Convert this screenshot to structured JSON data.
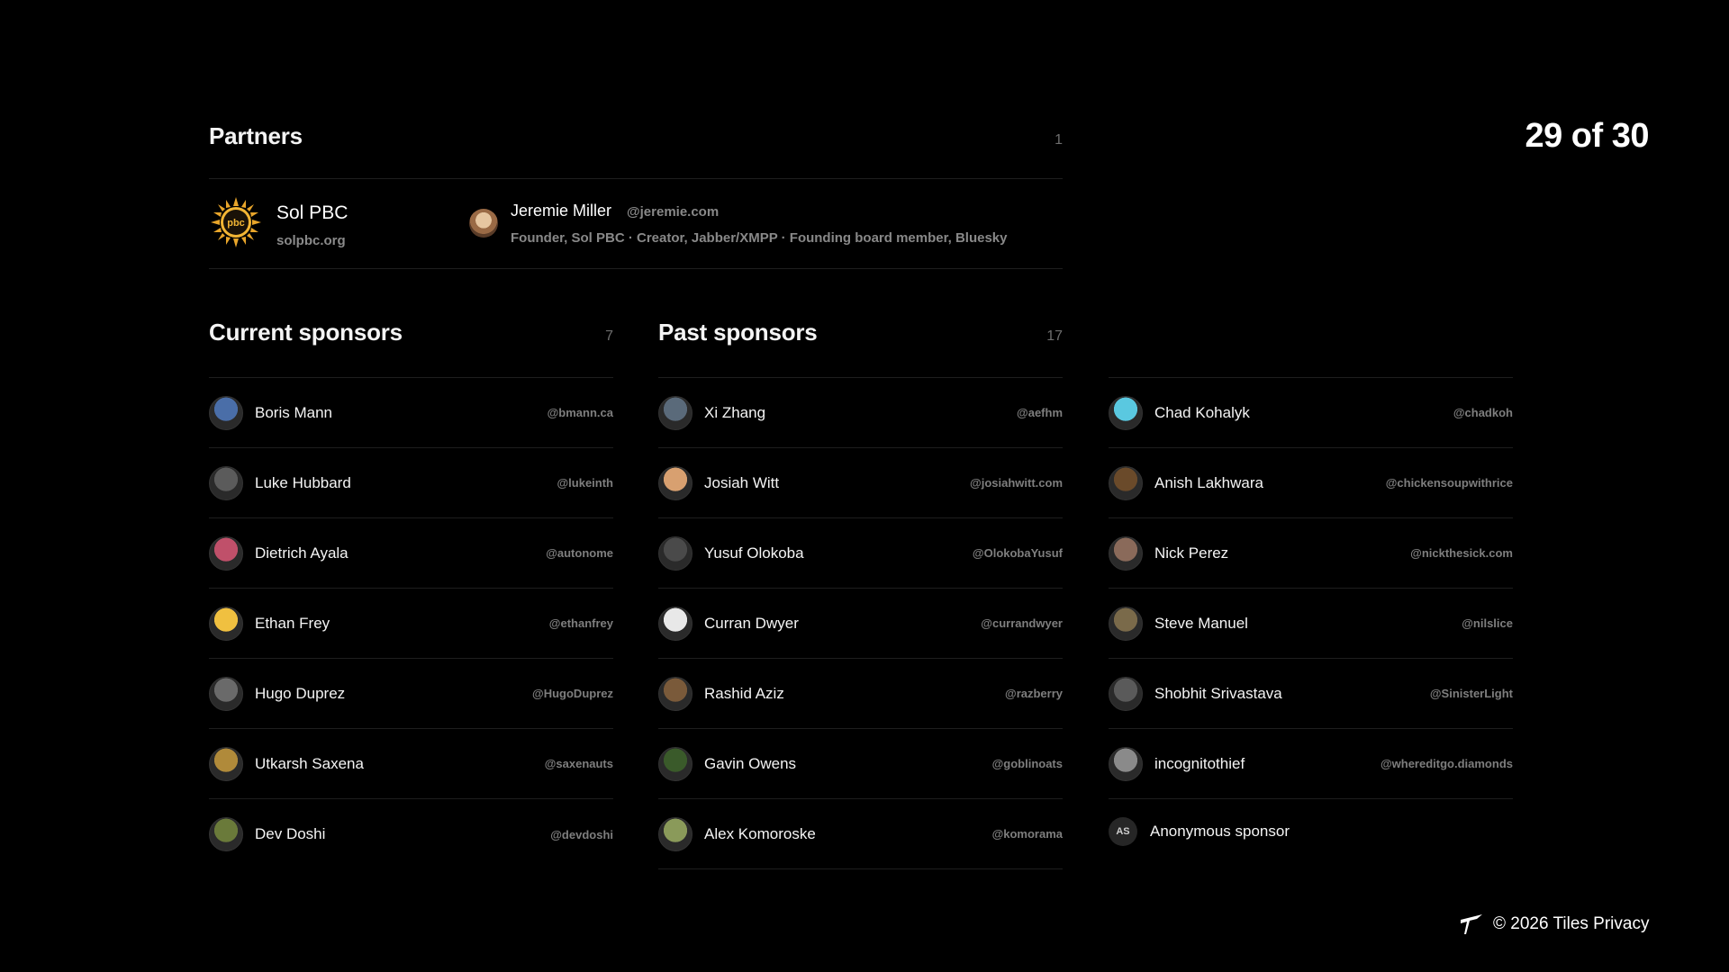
{
  "page_counter": "29 of 30",
  "partners": {
    "title": "Partners",
    "count": "1",
    "org_name": "Sol PBC",
    "org_site": "solpbc.org",
    "logo_text": "pbc",
    "person_name": "Jeremie Miller",
    "person_handle": "@jeremie.com",
    "person_bio": "Founder, Sol PBC · Creator, Jabber/XMPP · Founding board member, Bluesky"
  },
  "current_sponsors": {
    "title": "Current sponsors",
    "count": "7",
    "items": [
      {
        "name": "Boris Mann",
        "handle": "@bmann.ca",
        "color": "#4a6ea8"
      },
      {
        "name": "Luke Hubbard",
        "handle": "@lukeinth",
        "color": "#5b5b5b"
      },
      {
        "name": "Dietrich Ayala",
        "handle": "@autonome",
        "color": "#c0506a"
      },
      {
        "name": "Ethan Frey",
        "handle": "@ethanfrey",
        "color": "#f0c040"
      },
      {
        "name": "Hugo Duprez",
        "handle": "@HugoDuprez",
        "color": "#6a6a6a"
      },
      {
        "name": "Utkarsh Saxena",
        "handle": "@saxenauts",
        "color": "#b08a3a"
      },
      {
        "name": "Dev Doshi",
        "handle": "@devdoshi",
        "color": "#6a7a3a"
      }
    ]
  },
  "past_sponsors": {
    "title": "Past sponsors",
    "count": "17",
    "column_a": [
      {
        "name": "Xi Zhang",
        "handle": "@aefhm",
        "color": "#5a6a7a"
      },
      {
        "name": "Josiah Witt",
        "handle": "@josiahwitt.com",
        "color": "#d8a070"
      },
      {
        "name": "Yusuf Olokoba",
        "handle": "@OlokobaYusuf",
        "color": "#4a4a4a"
      },
      {
        "name": "Curran Dwyer",
        "handle": "@currandwyer",
        "color": "#e8e8e8"
      },
      {
        "name": "Rashid Aziz",
        "handle": "@razberry",
        "color": "#7a5a3a"
      },
      {
        "name": "Gavin Owens",
        "handle": "@goblinoats",
        "color": "#3a5a2a"
      },
      {
        "name": "Alex Komoroske",
        "handle": "@komorama",
        "color": "#8a9a5a"
      }
    ],
    "column_b": [
      {
        "name": "Chad Kohalyk",
        "handle": "@chadkoh",
        "color": "#5ac8e0"
      },
      {
        "name": "Anish Lakhwara",
        "handle": "@chickensoupwithrice",
        "color": "#6a4a2a"
      },
      {
        "name": "Nick Perez",
        "handle": "@nickthesick.com",
        "color": "#8a6a5a"
      },
      {
        "name": "Steve Manuel",
        "handle": "@nilslice",
        "color": "#7a6a4a"
      },
      {
        "name": "Shobhit Srivastava",
        "handle": "@SinisterLight",
        "color": "#5a5a5a"
      },
      {
        "name": "incognitothief",
        "handle": "@whereditgo.diamonds",
        "color": "#8a8a8a"
      }
    ],
    "anonymous": {
      "initials": "AS",
      "name": "Anonymous sponsor"
    }
  },
  "footer": {
    "text": "© 2026 Tiles Privacy"
  }
}
